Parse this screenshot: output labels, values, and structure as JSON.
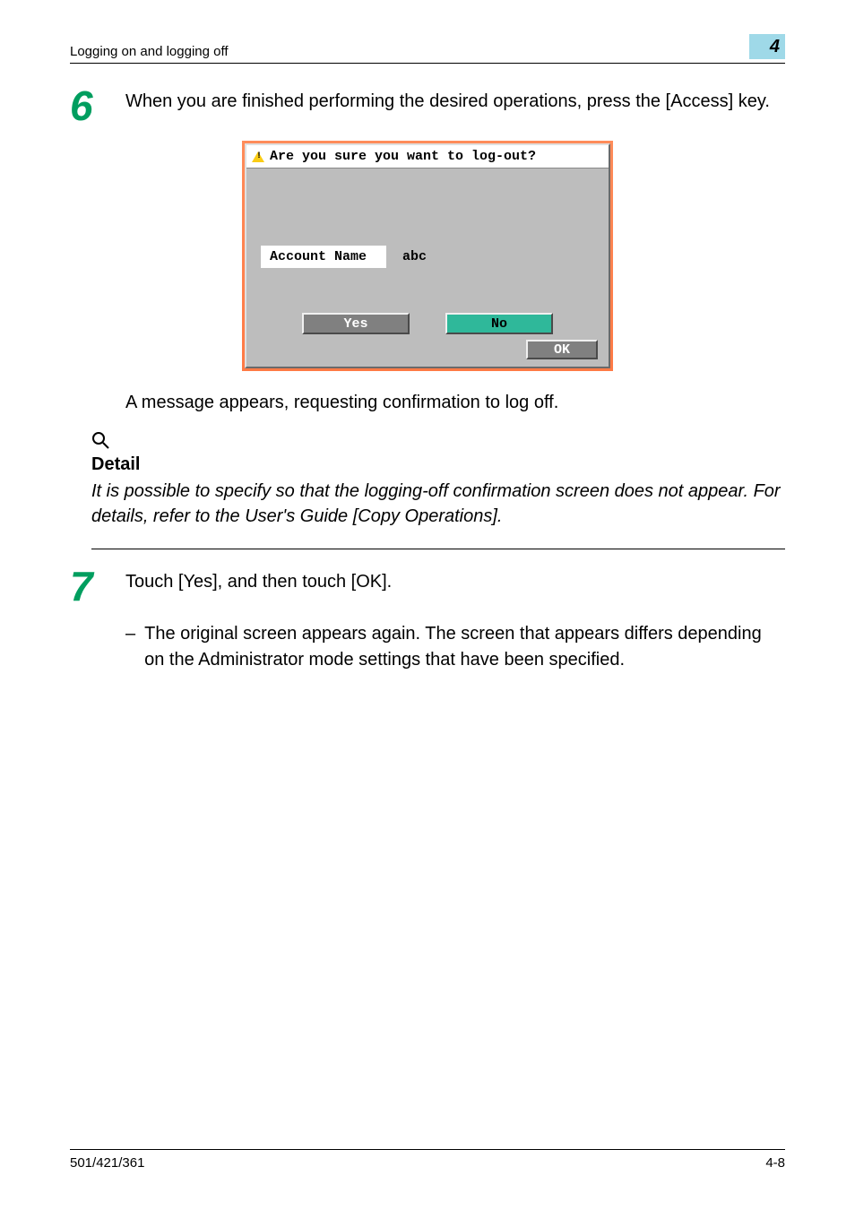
{
  "header": {
    "title": "Logging on and logging off",
    "chapter": "4"
  },
  "step6": {
    "num": "6",
    "text": "When you are finished performing the desired operations, press the [Access] key."
  },
  "dialog": {
    "prompt": "Are you sure you want to log-out?",
    "account_label": "Account Name",
    "account_value": "abc",
    "yes": "Yes",
    "no": "No",
    "ok": "OK"
  },
  "after_dialog": "A message appears, requesting confirmation to log off.",
  "detail": {
    "heading": "Detail",
    "body": "It is possible to specify so that the logging-off confirmation screen does not appear. For details, refer to the User's Guide [Copy Operations]."
  },
  "step7": {
    "num": "7",
    "text": "Touch [Yes], and then touch [OK].",
    "sub": "The original screen appears again. The screen that appears differs depending on the Administrator mode settings that have been specified."
  },
  "footer": {
    "left": "501/421/361",
    "right": "4-8"
  }
}
